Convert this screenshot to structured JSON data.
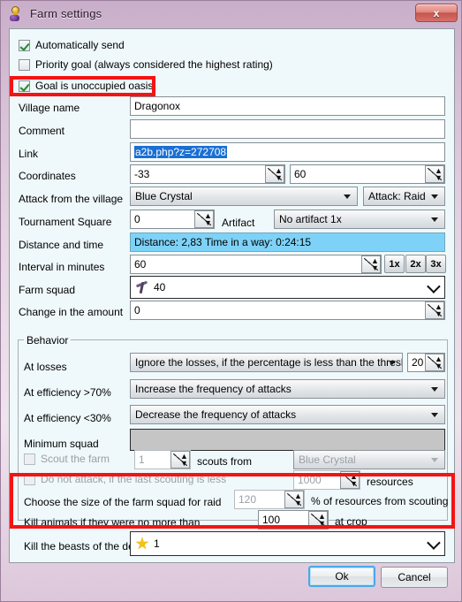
{
  "window": {
    "title": "Farm settings",
    "icon": "key-icon",
    "close_label": "x"
  },
  "checkboxes": {
    "auto_send": {
      "label": "Automatically send",
      "checked": true
    },
    "priority_goal": {
      "label": "Priority goal (always considered the highest rating)",
      "checked": false
    },
    "unoccupied_oasis": {
      "label": "Goal is unoccupied oasis",
      "checked": true
    }
  },
  "fields": {
    "village_name": {
      "label": "Village name",
      "value": "Dragonox"
    },
    "comment": {
      "label": "Comment",
      "value": ""
    },
    "link": {
      "label": "Link",
      "value": "a2b.php?z=272708",
      "selected": true
    },
    "coordinates": {
      "label": "Coordinates",
      "x": "-33",
      "y": "60"
    },
    "attack_from": {
      "label": "Attack from the village",
      "village": "Blue Crystal",
      "attack_type": "Attack: Raid"
    },
    "tournament_square": {
      "label": "Tournament Square",
      "value": "0"
    },
    "artifact": {
      "label": "Artifact",
      "value": "No artifact 1x"
    },
    "distance_time": {
      "label": "Distance and time",
      "value": "Distance: 2,83 Time in a way: 0:24:15"
    },
    "interval": {
      "label": "Interval in minutes",
      "value": "60",
      "multipliers": [
        "1x",
        "2x",
        "3x"
      ]
    },
    "farm_squad": {
      "label": "Farm squad",
      "value": "40",
      "icon": "unit-icon"
    },
    "change_amount": {
      "label": "Change in the amount",
      "value": "0"
    }
  },
  "behavior": {
    "group_title": "Behavior",
    "at_losses": {
      "label": "At losses",
      "value": "Ignore the losses, if the percentage is less than the threshold",
      "threshold": "20"
    },
    "eff_high": {
      "label": "At efficiency >70%",
      "value": "Increase the frequency of attacks"
    },
    "eff_low": {
      "label": "At efficiency <30%",
      "value": "Decrease the frequency of attacks"
    },
    "minimum_squad": {
      "label": "Minimum squad",
      "value": ""
    },
    "scout_farm": {
      "label": "Scout the farm",
      "checked": false,
      "count": "1",
      "from_label": "scouts from",
      "village": "Blue Crystal"
    },
    "no_attack": {
      "label": "Do not attack, if the last scouting is less",
      "checked": false,
      "value": "1000",
      "unit": "resources"
    },
    "raid_size": {
      "label": "Choose the size of the farm squad for raid",
      "value": "120",
      "unit": "% of resources from scouting"
    }
  },
  "animals": {
    "kill_animals": {
      "label": "Kill animals if they were no more than",
      "value": "100",
      "suffix": "at crop"
    },
    "kill_beasts": {
      "label": "Kill the beasts of the detachment",
      "value": "1",
      "icon": "star-icon"
    }
  },
  "buttons": {
    "ok": "Ok",
    "cancel": "Cancel"
  },
  "colors": {
    "highlight": "#7ed2f7",
    "selection": "#1a6fd4",
    "red_annotation": "#f31414",
    "titlebar": "#d8c2d6"
  }
}
